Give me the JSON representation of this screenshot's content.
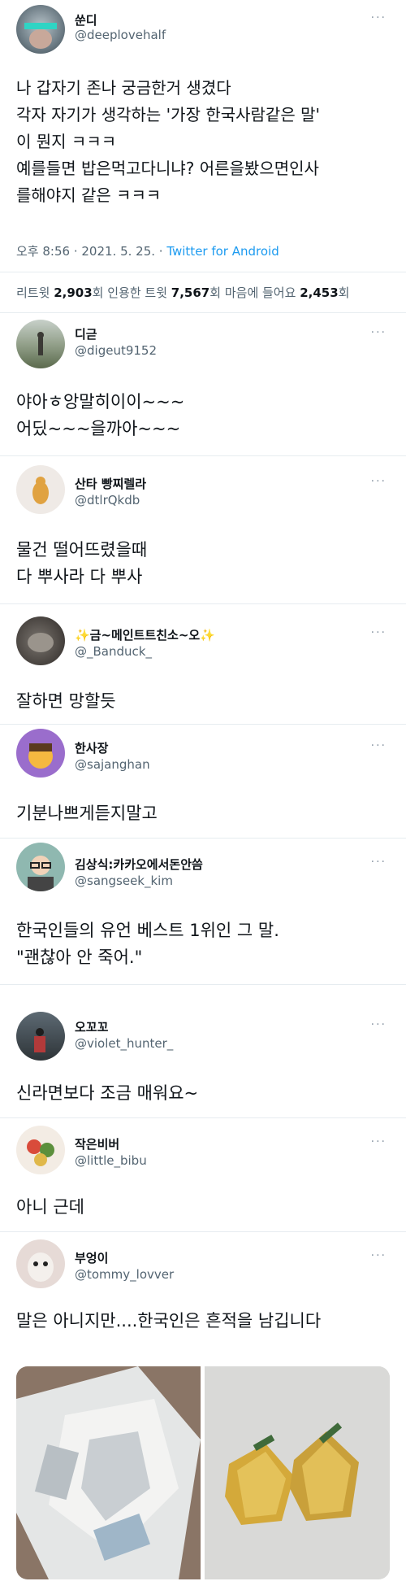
{
  "main_tweet": {
    "name": "쑨디",
    "handle": "@deeplovehalf",
    "lines": [
      "나 갑자기 존나 궁금한거 생겼다",
      "각자 자기가 생각하는 '가장 한국사람같은 말'",
      "이 뭔지 ㅋㅋㅋ",
      "예를들면 밥은먹고다니냐? 어른을봤으면인사",
      "를해야지 같은 ㅋㅋㅋ"
    ],
    "timestamp": "오후 8:56 · 2021. 5. 25. · ",
    "source": "Twitter for Android",
    "stats": {
      "retweets_label": "리트윗",
      "retweets": "2,903",
      "retweets_unit": "회",
      "quotes_label": "인용한 트윗",
      "quotes": "7,567",
      "quotes_unit": "회",
      "likes_label": "마음에 들어요",
      "likes": "2,453",
      "likes_unit": "회"
    }
  },
  "replies": [
    {
      "name": "디귿",
      "handle": "@digeut9152",
      "lines": [
        "야아ㅎ앙말히이이~~~",
        "어딨~~~을까아~~~"
      ]
    },
    {
      "name": "산타 빵찌렐라",
      "handle": "@dtlrQkdb",
      "lines": [
        "물건 떨어뜨렸을때",
        "다 뿌사라 다 뿌사"
      ]
    },
    {
      "name": "✨금~메인트트친소~오✨",
      "handle": "@_Banduck_",
      "lines": [
        "잘하면 망할듯"
      ]
    },
    {
      "name": "한사장",
      "handle": "@sajanghan",
      "lines": [
        "기분나쁘게듣지말고"
      ]
    },
    {
      "name": "김상식:카카오에서돈안씀",
      "handle": "@sangseek_kim",
      "lines": [
        "한국인들의 유언 베스트 1위인 그 말.",
        "\"괜찮아 안 죽어.\""
      ]
    },
    {
      "name": "오꼬꼬",
      "handle": "@violet_hunter_",
      "lines": [
        "신라면보다 조금 매워요~"
      ]
    },
    {
      "name": "작은비버",
      "handle": "@little_bibu",
      "lines": [
        "아니 근데"
      ]
    },
    {
      "name": "부엉이",
      "handle": "@tommy_lovver",
      "lines": [
        "말은 아니지만....한국인은 흔적을 남깁니다"
      ]
    }
  ],
  "more_icon": "···"
}
